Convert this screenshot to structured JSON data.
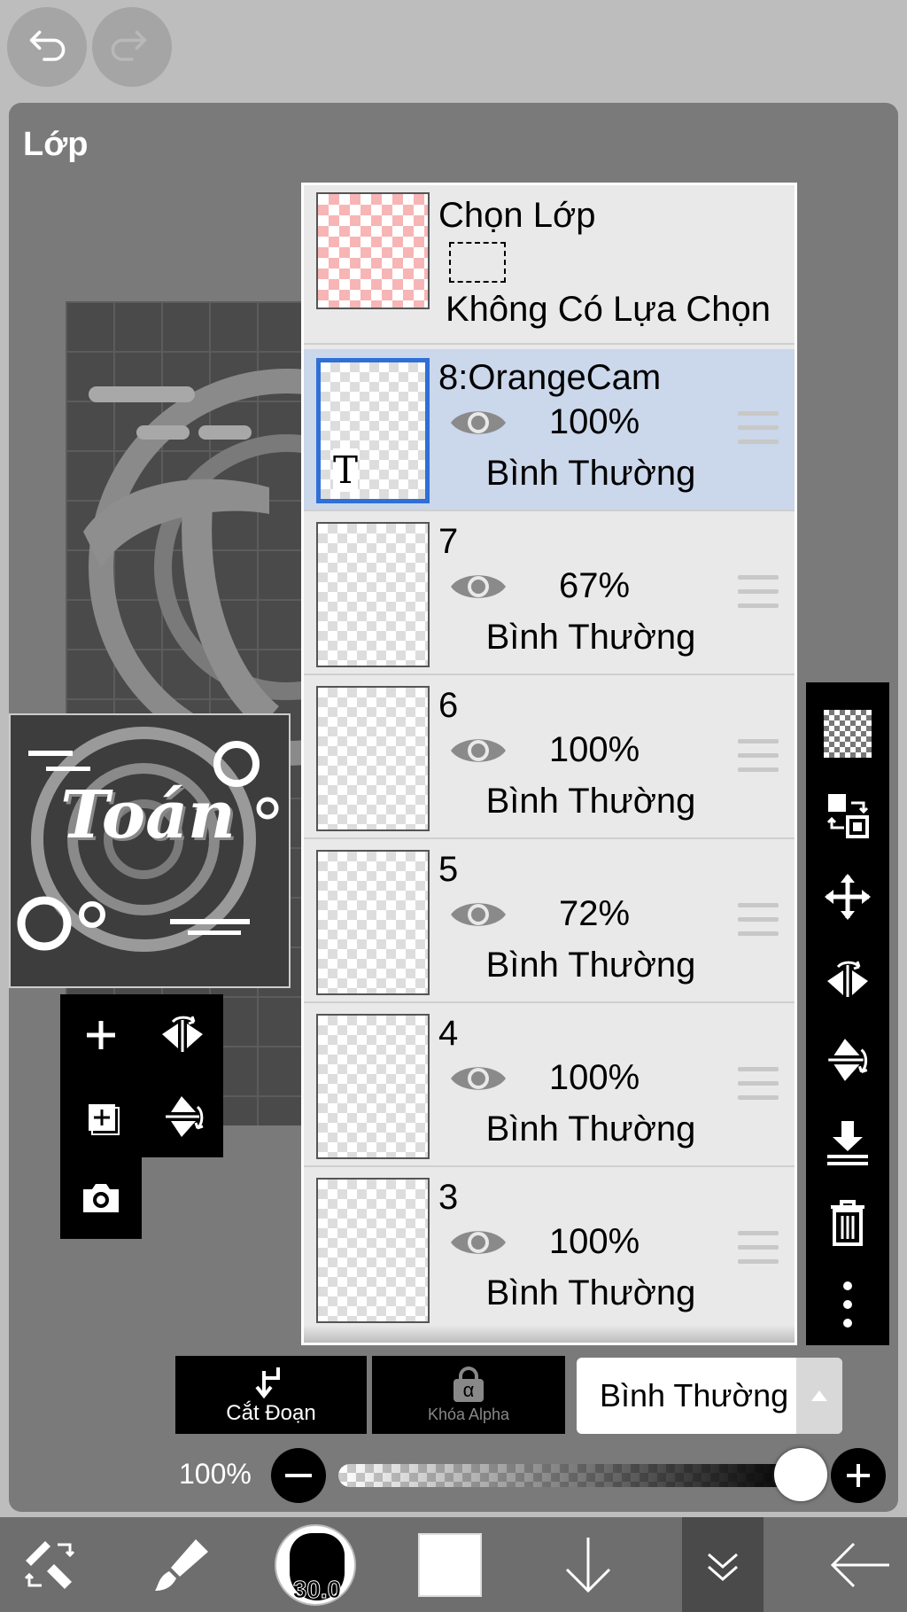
{
  "top": {
    "undo_icon": "undo-arrow",
    "redo_icon": "redo-arrow"
  },
  "panel": {
    "title": "Lớp"
  },
  "selection_layer": {
    "title": "Chọn Lớp",
    "status": "Không Có Lựa Chọn"
  },
  "layers": [
    {
      "name": "8:OrangeCam",
      "opacity": "100%",
      "mode": "Bình Thường",
      "selected": true,
      "type_marker": "T"
    },
    {
      "name": "7",
      "opacity": "67%",
      "mode": "Bình Thường",
      "selected": false
    },
    {
      "name": "6",
      "opacity": "100%",
      "mode": "Bình Thường",
      "selected": false
    },
    {
      "name": "5",
      "opacity": "72%",
      "mode": "Bình Thường",
      "selected": false
    },
    {
      "name": "4",
      "opacity": "100%",
      "mode": "Bình Thường",
      "selected": false
    },
    {
      "name": "3",
      "opacity": "100%",
      "mode": "Bình Thường",
      "selected": false
    }
  ],
  "artwork": {
    "thumbnail_text": "Toán"
  },
  "actions": {
    "clip_label": "Cắt Đoạn",
    "alpha_lock_label": "Khóa Alpha",
    "alpha_symbol": "α"
  },
  "blend": {
    "selected": "Bình Thường"
  },
  "opacity": {
    "label": "100%",
    "value": 1.0
  },
  "brush": {
    "size": "30.0"
  },
  "colors": {
    "accent": "#2f6fd6",
    "selected_row": "#cbd7ea",
    "panel": "#7a7a7a",
    "toolbar": "#6e6e6e"
  }
}
